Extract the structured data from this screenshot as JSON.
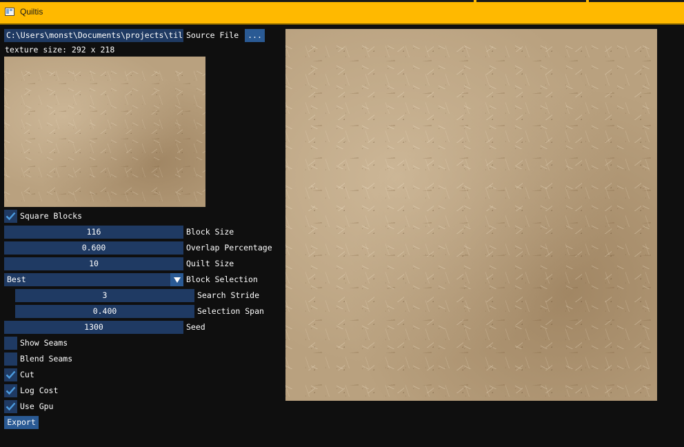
{
  "window": {
    "title": "Quiltis"
  },
  "source": {
    "path": "C:\\Users\\monst\\Documents\\projects\\til",
    "label": "Source File",
    "browse_label": "..."
  },
  "texture_size_text": "texture size: 292 x 218",
  "controls": {
    "square_blocks": {
      "label": "Square Blocks",
      "checked": true
    },
    "block_size": {
      "value": "116",
      "label": "Block Size"
    },
    "overlap_percentage": {
      "value": "0.600",
      "label": "Overlap Percentage"
    },
    "quilt_size": {
      "value": "10",
      "label": "Quilt Size"
    },
    "block_selection": {
      "value": "Best",
      "label": "Block Selection"
    },
    "search_stride": {
      "value": "3",
      "label": "Search Stride"
    },
    "selection_span": {
      "value": "0.400",
      "label": "Selection Span"
    },
    "seed": {
      "value": "1300",
      "label": "Seed"
    },
    "show_seams": {
      "label": "Show Seams",
      "checked": false
    },
    "blend_seams": {
      "label": "Blend Seams",
      "checked": false
    },
    "cut": {
      "label": "Cut",
      "checked": true
    },
    "log_cost": {
      "label": "Log Cost",
      "checked": true
    },
    "use_gpu": {
      "label": "Use Gpu",
      "checked": true
    }
  },
  "export_label": "Export",
  "colors": {
    "titlebar": "#ffb900",
    "background": "#0f0f0f",
    "field": "#1f3a63",
    "button": "#2a5a94",
    "checkmark": "#4d9de0"
  }
}
